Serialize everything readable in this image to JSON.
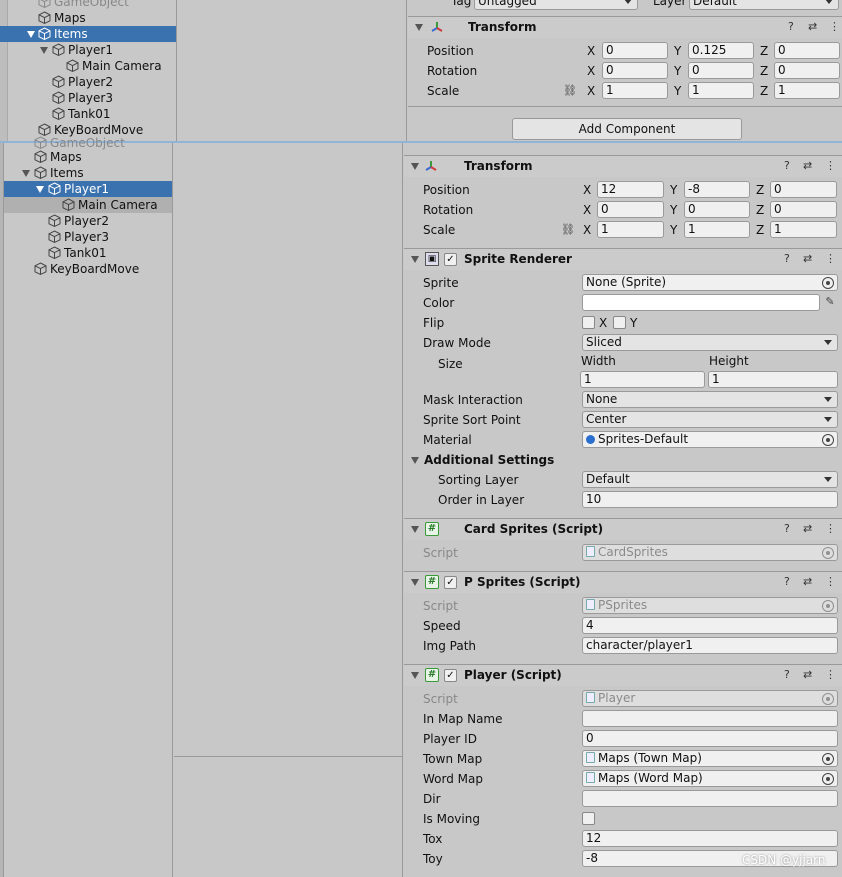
{
  "top_hierarchy": {
    "items": [
      {
        "label": "GameObject",
        "dim": true
      },
      {
        "label": "Maps"
      },
      {
        "label": "Items",
        "selected": true
      },
      {
        "label": "Player1"
      },
      {
        "label": "Main Camera"
      },
      {
        "label": "Player2"
      },
      {
        "label": "Player3"
      },
      {
        "label": "Tank01"
      },
      {
        "label": "KeyBoardMove"
      }
    ]
  },
  "top_inspector": {
    "tag_label": "Tag",
    "tag_value": "Untagged",
    "layer_label": "Layer",
    "layer_value": "Default",
    "transform_title": "Transform",
    "position_label": "Position",
    "rotation_label": "Rotation",
    "scale_label": "Scale",
    "position": {
      "x": "0",
      "y": "0.125",
      "z": "0"
    },
    "rotation": {
      "x": "0",
      "y": "0",
      "z": "0"
    },
    "scale": {
      "x": "1",
      "y": "1",
      "z": "1"
    },
    "add_component": "Add Component"
  },
  "hierarchy": {
    "items": [
      {
        "label": "GameObject",
        "dim": true
      },
      {
        "label": "Maps"
      },
      {
        "label": "Items"
      },
      {
        "label": "Player1",
        "selected": true
      },
      {
        "label": "Main Camera"
      },
      {
        "label": "Player2"
      },
      {
        "label": "Player3"
      },
      {
        "label": "Tank01"
      },
      {
        "label": "KeyBoardMove"
      }
    ]
  },
  "axes": {
    "x": "X",
    "y": "Y",
    "z": "Z"
  },
  "transform": {
    "title": "Transform",
    "position_label": "Position",
    "rotation_label": "Rotation",
    "scale_label": "Scale",
    "position": {
      "x": "12",
      "y": "-8",
      "z": "0"
    },
    "rotation": {
      "x": "0",
      "y": "0",
      "z": "0"
    },
    "scale": {
      "x": "1",
      "y": "1",
      "z": "1"
    }
  },
  "sprite_renderer": {
    "title": "Sprite Renderer",
    "sprite_label": "Sprite",
    "sprite_value": "None (Sprite)",
    "color_label": "Color",
    "flip_label": "Flip",
    "flip_x": "X",
    "flip_y": "Y",
    "draw_mode_label": "Draw Mode",
    "draw_mode_value": "Sliced",
    "size_label": "Size",
    "width_label": "Width",
    "height_label": "Height",
    "width_value": "1",
    "height_value": "1",
    "mask_label": "Mask Interaction",
    "mask_value": "None",
    "sort_point_label": "Sprite Sort Point",
    "sort_point_value": "Center",
    "material_label": "Material",
    "material_value": "Sprites-Default",
    "additional_label": "Additional Settings",
    "sorting_layer_label": "Sorting Layer",
    "sorting_layer_value": "Default",
    "order_label": "Order in Layer",
    "order_value": "10"
  },
  "card_sprites": {
    "title": "Card Sprites (Script)",
    "script_label": "Script",
    "script_value": "CardSprites"
  },
  "p_sprites": {
    "title": "P Sprites (Script)",
    "script_label": "Script",
    "script_value": "PSprites",
    "speed_label": "Speed",
    "speed_value": "4",
    "img_path_label": "Img Path",
    "img_path_value": "character/player1"
  },
  "player": {
    "title": "Player (Script)",
    "script_label": "Script",
    "script_value": "Player",
    "in_map_name_label": "In Map Name",
    "in_map_name_value": "",
    "player_id_label": "Player ID",
    "player_id_value": "0",
    "town_map_label": "Town Map",
    "town_map_value": "Maps (Town Map)",
    "word_map_label": "Word Map",
    "word_map_value": "Maps (Word Map)",
    "dir_label": "Dir",
    "dir_value": "",
    "is_moving_label": "Is Moving",
    "tox_label": "Tox",
    "tox_value": "12",
    "toy_label": "Toy",
    "toy_value": "-8"
  },
  "header_icons": {
    "help": "?",
    "settings": "⇄",
    "menu": "⋮"
  },
  "watermark": "CSDN @yjjarn"
}
